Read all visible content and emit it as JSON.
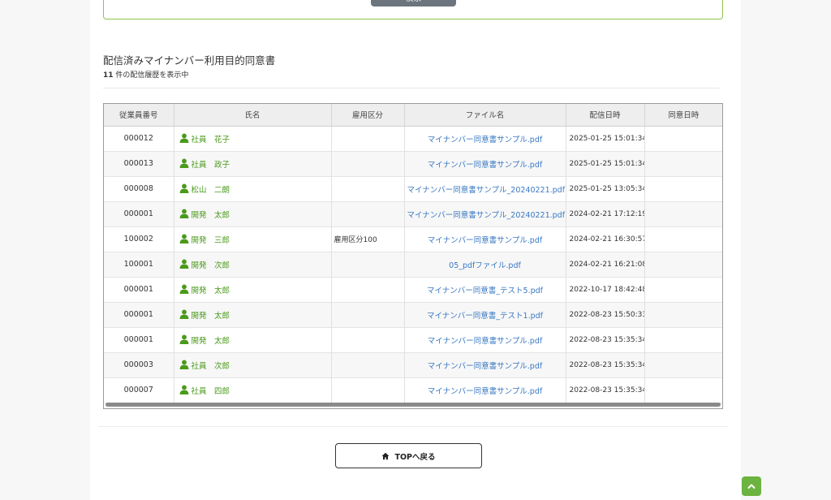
{
  "search": {
    "button_label": "検索"
  },
  "section": {
    "title": "配信済みマイナンバー利用目的同意書",
    "count": "11",
    "count_suffix": " 件の配信履歴を表示中"
  },
  "table": {
    "headers": [
      "従業員番号",
      "氏名",
      "雇用区分",
      "ファイル名",
      "配信日時",
      "同意日時"
    ],
    "rows": [
      {
        "id": "000012",
        "name": "社員　花子",
        "type": "",
        "file": "マイナンバー同意書サンプル.pdf",
        "sent": "2025-01-25 15:01:34",
        "agreed": ""
      },
      {
        "id": "000013",
        "name": "社員　政子",
        "type": "",
        "file": "マイナンバー同意書サンプル.pdf",
        "sent": "2025-01-25 15:01:34",
        "agreed": ""
      },
      {
        "id": "000008",
        "name": "松山　二朗",
        "type": "",
        "file": "マイナンバー同意書サンプル_20240221.pdf",
        "sent": "2025-01-25 13:05:34",
        "agreed": ""
      },
      {
        "id": "000001",
        "name": "開発　太郎",
        "type": "",
        "file": "マイナンバー同意書サンプル_20240221.pdf",
        "sent": "2024-02-21 17:12:19",
        "agreed": ""
      },
      {
        "id": "100002",
        "name": "開発　三郎",
        "type": "雇用区分100",
        "file": "マイナンバー同意書サンプル.pdf",
        "sent": "2024-02-21 16:30:57",
        "agreed": ""
      },
      {
        "id": "100001",
        "name": "開発　次郎",
        "type": "",
        "file": "05_pdfファイル.pdf",
        "sent": "2024-02-21 16:21:08",
        "agreed": ""
      },
      {
        "id": "000001",
        "name": "開発　太郎",
        "type": "",
        "file": "マイナンバー同意書_テスト5.pdf",
        "sent": "2022-10-17 18:42:48",
        "agreed": ""
      },
      {
        "id": "000001",
        "name": "開発　太郎",
        "type": "",
        "file": "マイナンバー同意書_テスト1.pdf",
        "sent": "2022-08-23 15:50:33",
        "agreed": ""
      },
      {
        "id": "000001",
        "name": "開発　太郎",
        "type": "",
        "file": "マイナンバー同意書サンプル.pdf",
        "sent": "2022-08-23 15:35:34",
        "agreed": ""
      },
      {
        "id": "000003",
        "name": "社員　次郎",
        "type": "",
        "file": "マイナンバー同意書サンプル.pdf",
        "sent": "2022-08-23 15:35:34",
        "agreed": ""
      },
      {
        "id": "000007",
        "name": "社員　四郎",
        "type": "",
        "file": "マイナンバー同意書サンプル.pdf",
        "sent": "2022-08-23 15:35:34",
        "agreed": ""
      }
    ]
  },
  "footer": {
    "top_button_label": "TOPへ戻る"
  },
  "icons": {
    "person": "person-icon",
    "home": "home-icon",
    "scroll_top": "chevron-up-icon",
    "search": "search-icon"
  },
  "colors": {
    "accent": "#6cb33f",
    "link": "#3a78c2",
    "name": "#4a9a1a"
  }
}
